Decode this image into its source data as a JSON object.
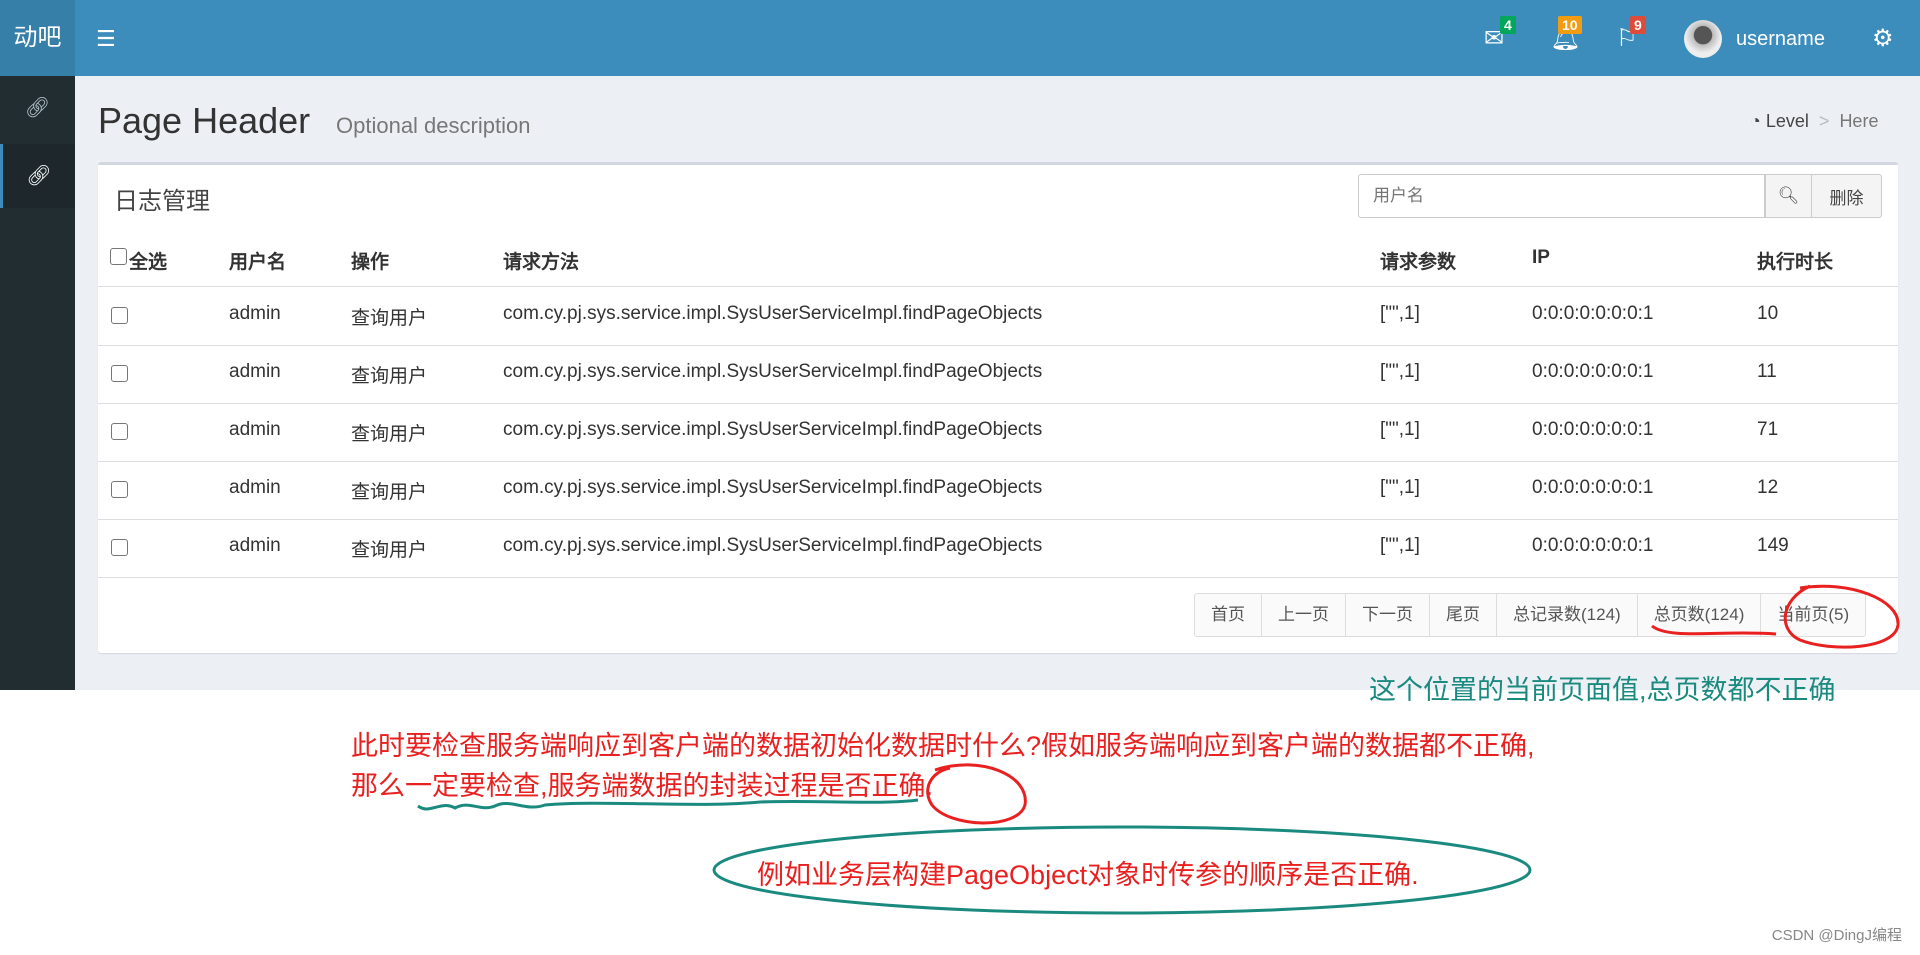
{
  "header": {
    "logo": "动吧",
    "menu_icon": "hamburger-icon",
    "messages_count": "4",
    "notifications_count": "10",
    "tasks_count": "9",
    "username": "username",
    "colors": {
      "bar": "#3c8dbc",
      "badge_messages": "#00a65a",
      "badge_notifications": "#f39c12",
      "badge_tasks": "#dd4b39"
    }
  },
  "sidebar": {
    "items": [
      {
        "icon": "link-icon"
      },
      {
        "icon": "link-icon",
        "active": true
      }
    ]
  },
  "page_header": {
    "title": "Page Header",
    "description": "Optional description",
    "breadcrumb": {
      "level": "Level",
      "separator": ">",
      "here": "Here"
    }
  },
  "box": {
    "title": "日志管理",
    "search_placeholder": "用户名",
    "delete_label": "删除"
  },
  "table": {
    "columns": [
      "全选",
      "用户名",
      "操作",
      "请求方法",
      "请求参数",
      "IP",
      "执行时长"
    ],
    "rows": [
      {
        "user": "admin",
        "op": "查询用户",
        "method": "com.cy.pj.sys.service.impl.SysUserServiceImpl.findPageObjects",
        "params": "[\"\",1]",
        "ip": "0:0:0:0:0:0:0:1",
        "time": "10"
      },
      {
        "user": "admin",
        "op": "查询用户",
        "method": "com.cy.pj.sys.service.impl.SysUserServiceImpl.findPageObjects",
        "params": "[\"\",1]",
        "ip": "0:0:0:0:0:0:0:1",
        "time": "11"
      },
      {
        "user": "admin",
        "op": "查询用户",
        "method": "com.cy.pj.sys.service.impl.SysUserServiceImpl.findPageObjects",
        "params": "[\"\",1]",
        "ip": "0:0:0:0:0:0:0:1",
        "time": "71"
      },
      {
        "user": "admin",
        "op": "查询用户",
        "method": "com.cy.pj.sys.service.impl.SysUserServiceImpl.findPageObjects",
        "params": "[\"\",1]",
        "ip": "0:0:0:0:0:0:0:1",
        "time": "12"
      },
      {
        "user": "admin",
        "op": "查询用户",
        "method": "com.cy.pj.sys.service.impl.SysUserServiceImpl.findPageObjects",
        "params": "[\"\",1]",
        "ip": "0:0:0:0:0:0:0:1",
        "time": "149"
      }
    ]
  },
  "pagination": [
    "首页",
    "上一页",
    "下一页",
    "尾页",
    "总记录数(124)",
    "总页数(124)",
    "当前页(5)"
  ],
  "annotations": {
    "teal_note": "这个位置的当前页面值,总页数都不正确",
    "red_line1": "此时要检查服务端响应到客户端的数据初始化数据时什么?假如服务端响应到客户端的数据都不正确,",
    "red_line2": "那么一定要检查,服务端数据的封装过程是否正确.",
    "ellipse_note": "例如业务层构建PageObject对象时传参的顺序是否正确.",
    "colors": {
      "red": "#e8201f",
      "teal": "#1a8a7f"
    }
  },
  "watermark": "CSDN @DingJ编程"
}
